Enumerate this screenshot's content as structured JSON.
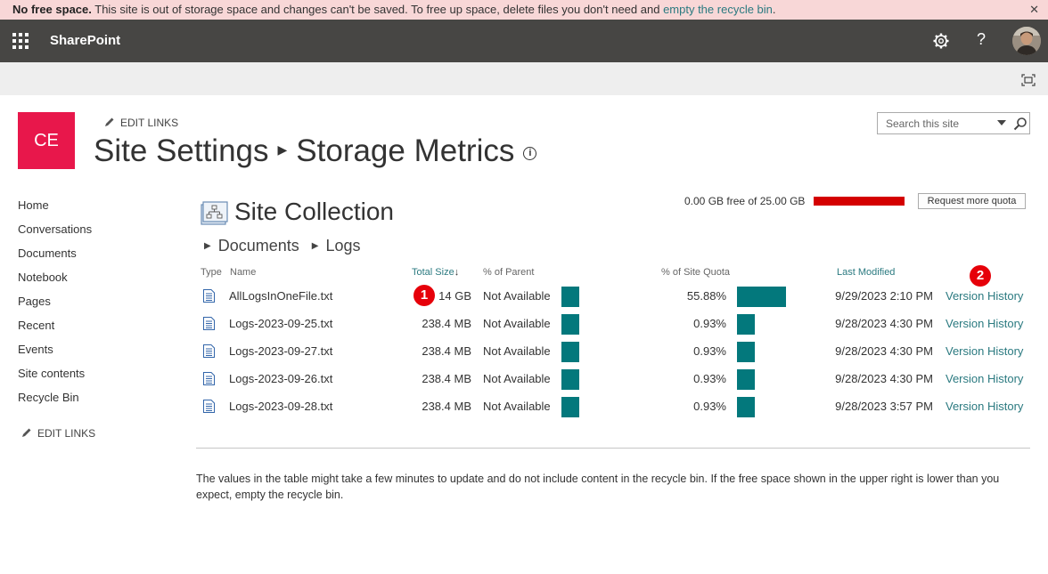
{
  "banner": {
    "bold": "No free space.",
    "text": " This site is out of storage space and changes can't be saved. To free up space, delete files you don't need and ",
    "link": "empty the recycle bin",
    "end": "."
  },
  "suite": {
    "brand": "SharePoint",
    "help": "?"
  },
  "logo": {
    "initials": "CE",
    "color": "#e8174b"
  },
  "edit_links": "EDIT LINKS",
  "title": {
    "part1": "Site Settings",
    "part2": "Storage Metrics",
    "info": "i"
  },
  "search": {
    "placeholder": "Search this site"
  },
  "nav": [
    "Home",
    "Conversations",
    "Documents",
    "Notebook",
    "Pages",
    "Recent",
    "Events",
    "Site contents",
    "Recycle Bin"
  ],
  "quota": {
    "text": "0.00 GB free of 25.00 GB",
    "used_fraction": 1.0,
    "button": "Request more quota",
    "bar_color": "#d40000"
  },
  "heading": "Site Collection",
  "breadcrumb": [
    "Documents",
    "Logs"
  ],
  "table": {
    "headers": {
      "type": "Type",
      "name": "Name",
      "size": "Total Size",
      "size_arrow": "↓",
      "parent": "% of Parent",
      "quota": "% of Site Quota",
      "modified": "Last Modified"
    },
    "rows": [
      {
        "name": "AllLogsInOneFile.txt",
        "size": "14 GB",
        "parent": "Not Available",
        "quota": "55.88%",
        "quota_value": 55.88,
        "modified": "9/29/2023 2:10 PM",
        "action": "Version History"
      },
      {
        "name": "Logs-2023-09-25.txt",
        "size": "238.4 MB",
        "parent": "Not Available",
        "quota": "0.93%",
        "quota_value": 0.93,
        "modified": "9/28/2023 4:30 PM",
        "action": "Version History"
      },
      {
        "name": "Logs-2023-09-27.txt",
        "size": "238.4 MB",
        "parent": "Not Available",
        "quota": "0.93%",
        "quota_value": 0.93,
        "modified": "9/28/2023 4:30 PM",
        "action": "Version History"
      },
      {
        "name": "Logs-2023-09-26.txt",
        "size": "238.4 MB",
        "parent": "Not Available",
        "quota": "0.93%",
        "quota_value": 0.93,
        "modified": "9/28/2023 4:30 PM",
        "action": "Version History"
      },
      {
        "name": "Logs-2023-09-28.txt",
        "size": "238.4 MB",
        "parent": "Not Available",
        "quota": "0.93%",
        "quota_value": 0.93,
        "modified": "9/28/2023 3:57 PM",
        "action": "Version History"
      }
    ],
    "bar_color": "#03787c"
  },
  "badges": [
    "1",
    "2"
  ],
  "note": "The values in the table might take a few minutes to update and do not include content in the recycle bin. If the free space shown in the upper right is lower than you expect, empty the recycle bin."
}
